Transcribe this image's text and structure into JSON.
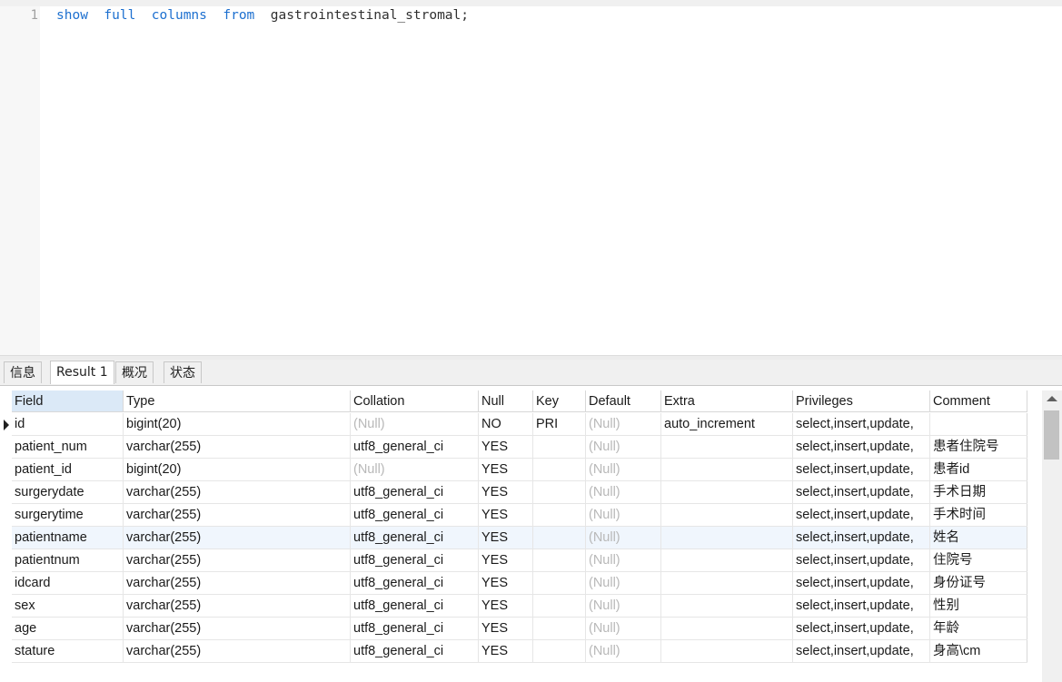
{
  "editor": {
    "line_number": "1",
    "kw1": "show",
    "kw2": "full",
    "kw3": "columns",
    "kw4": "from",
    "table_name": "gastrointestinal_stromal;"
  },
  "tabs": [
    {
      "label": "信息",
      "active": false
    },
    {
      "label": "Result 1",
      "active": true
    },
    {
      "label": "概况",
      "active": false
    },
    {
      "label": "状态",
      "active": false
    }
  ],
  "grid": {
    "columns": [
      "Field",
      "Type",
      "Collation",
      "Null",
      "Key",
      "Default",
      "Extra",
      "Privileges",
      "Comment"
    ],
    "rows": [
      [
        "id",
        "bigint(20)",
        "(Null)",
        "NO",
        "PRI",
        "(Null)",
        "auto_increment",
        "select,insert,update,",
        ""
      ],
      [
        "patient_num",
        "varchar(255)",
        "utf8_general_ci",
        "YES",
        "",
        "(Null)",
        "",
        "select,insert,update,",
        "患者住院号"
      ],
      [
        "patient_id",
        "bigint(20)",
        "(Null)",
        "YES",
        "",
        "(Null)",
        "",
        "select,insert,update,",
        "患者id"
      ],
      [
        "surgerydate",
        "varchar(255)",
        "utf8_general_ci",
        "YES",
        "",
        "(Null)",
        "",
        "select,insert,update,",
        "手术日期"
      ],
      [
        "surgerytime",
        "varchar(255)",
        "utf8_general_ci",
        "YES",
        "",
        "(Null)",
        "",
        "select,insert,update,",
        "手术时间"
      ],
      [
        "patientname",
        "varchar(255)",
        "utf8_general_ci",
        "YES",
        "",
        "(Null)",
        "",
        "select,insert,update,",
        "姓名"
      ],
      [
        "patientnum",
        "varchar(255)",
        "utf8_general_ci",
        "YES",
        "",
        "(Null)",
        "",
        "select,insert,update,",
        "住院号"
      ],
      [
        "idcard",
        "varchar(255)",
        "utf8_general_ci",
        "YES",
        "",
        "(Null)",
        "",
        "select,insert,update,",
        "身份证号"
      ],
      [
        "sex",
        "varchar(255)",
        "utf8_general_ci",
        "YES",
        "",
        "(Null)",
        "",
        "select,insert,update,",
        "性别"
      ],
      [
        "age",
        "varchar(255)",
        "utf8_general_ci",
        "YES",
        "",
        "(Null)",
        "",
        "select,insert,update,",
        "年龄"
      ],
      [
        "stature",
        "varchar(255)",
        "utf8_general_ci",
        "YES",
        "",
        "(Null)",
        "",
        "select,insert,update,",
        "身高\\cm"
      ]
    ],
    "highlighted_row": 5,
    "current_row_marker": "row-pointer-icon"
  },
  "colors": {
    "keyword": "#1c6fcf",
    "null_text": "#b8b8b8",
    "selected_header": "#dbe9f7"
  }
}
